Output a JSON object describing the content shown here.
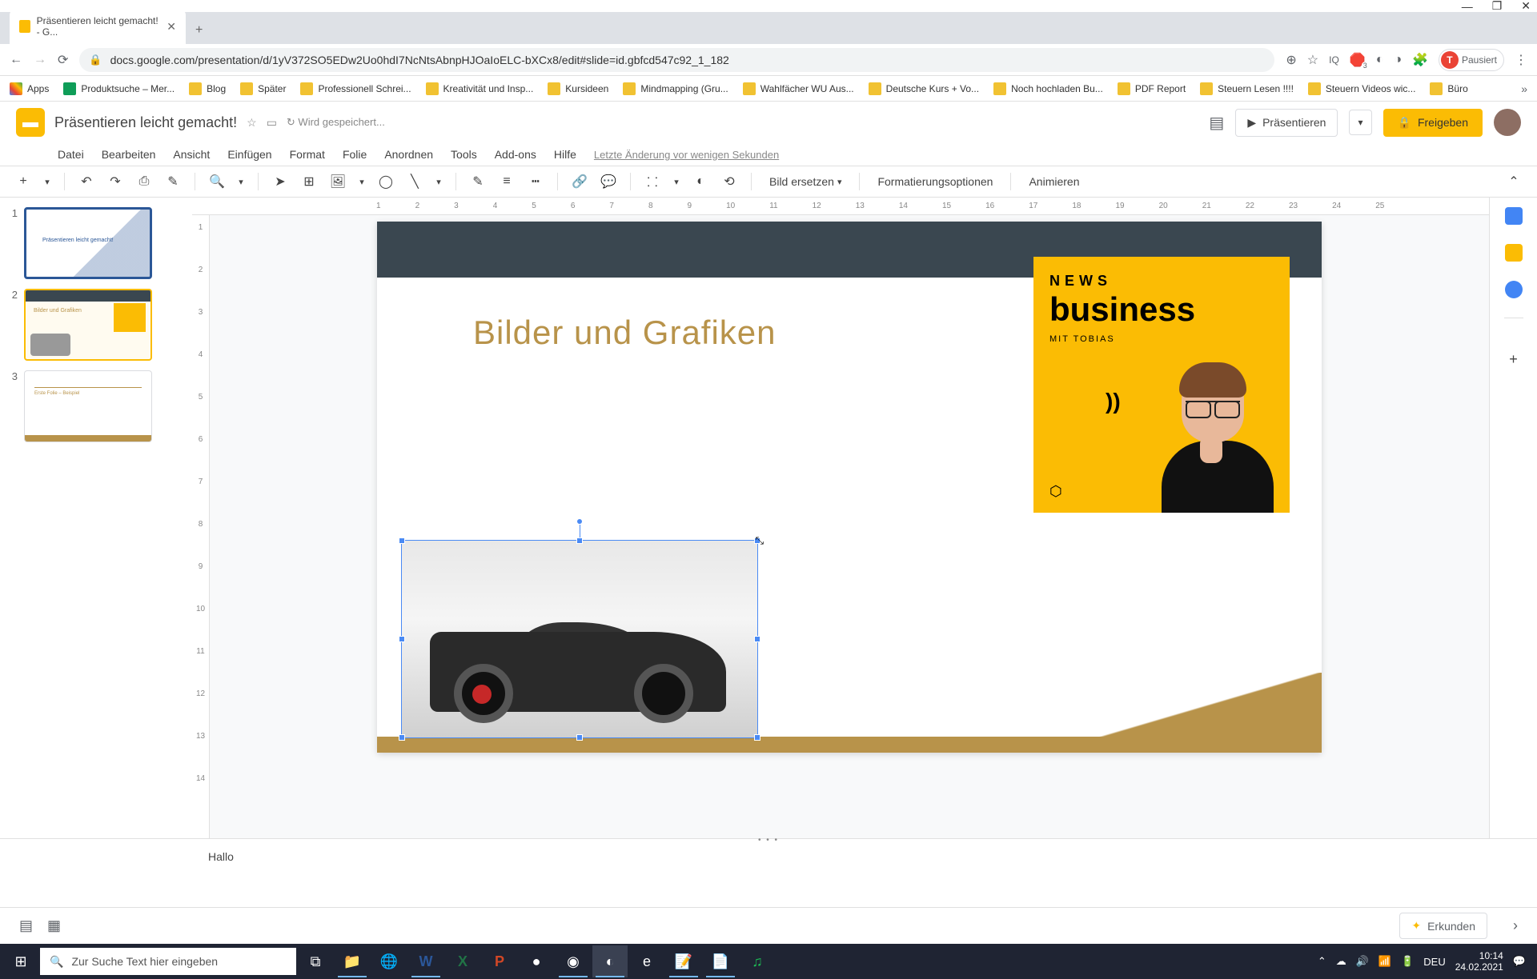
{
  "window": {
    "minimize": "—",
    "maximize": "❐",
    "close": "✕"
  },
  "browser": {
    "tab_title": "Präsentieren leicht gemacht! - G...",
    "tab_close": "✕",
    "new_tab": "+",
    "back": "←",
    "forward": "→",
    "reload": "⟳",
    "url": "docs.google.com/presentation/d/1yV372SO5EDw2Uo0hdI7NcNtsAbnpHJOaIoELC-bXCx8/edit#slide=id.gbfcd547c92_1_182",
    "zoom_icon": "⊕",
    "star": "☆",
    "reader": "IQ",
    "puzzle": "🧩",
    "blocker_count": "3",
    "menu": "⋮",
    "profile_label": "Pausiert",
    "profile_letter": "T"
  },
  "bookmarks": [
    "Apps",
    "Produktsuche – Mer...",
    "Blog",
    "Später",
    "Professionell Schrei...",
    "Kreativität und Insp...",
    "Kursideen",
    "Mindmapping  (Gru...",
    "Wahlfächer WU Aus...",
    "Deutsche Kurs + Vo...",
    "Noch hochladen Bu...",
    "PDF Report",
    "Steuern Lesen !!!!",
    "Steuern Videos wic...",
    "Büro"
  ],
  "bookmarks_more": "»",
  "app": {
    "title": "Präsentieren leicht gemacht!",
    "star": "☆",
    "move": "▭",
    "saving": "↻  Wird gespeichert...",
    "comment": "▤",
    "present_icon": "▶",
    "present": "Präsentieren",
    "present_dd": "▾",
    "share_icon": "🔒",
    "share": "Freigeben"
  },
  "menu": {
    "items": [
      "Datei",
      "Bearbeiten",
      "Ansicht",
      "Einfügen",
      "Format",
      "Folie",
      "Anordnen",
      "Tools",
      "Add-ons",
      "Hilfe"
    ],
    "last_edit": "Letzte Änderung vor wenigen Sekunden"
  },
  "toolbar": {
    "new_slide": "+",
    "new_dd": "▾",
    "undo": "↶",
    "redo": "↷",
    "print": "⎙",
    "paint": "✎",
    "zoom": "🔍",
    "zoom_dd": "▾",
    "select": "➤",
    "textbox": "⊞",
    "image": "🖼",
    "image_dd": "▾",
    "shape": "◯",
    "line": "╲",
    "line_dd": "▾",
    "border_color": "✎",
    "border_weight": "≡",
    "border_dash": "┅",
    "link": "🔗",
    "comment": "💬",
    "crop": "⸬",
    "crop_dd": "▾",
    "mask": "◐",
    "reset": "⟲",
    "replace_image": "Bild ersetzen",
    "replace_dd": "▾",
    "format_options": "Formatierungsoptionen",
    "animate": "Animieren",
    "collapse": "⌃"
  },
  "ruler_h": [
    "1",
    "2",
    "3",
    "4",
    "5",
    "6",
    "7",
    "8",
    "9",
    "10",
    "11",
    "12",
    "13",
    "14",
    "15",
    "16",
    "17",
    "18",
    "19",
    "20",
    "21",
    "22",
    "23",
    "24",
    "25"
  ],
  "ruler_v": [
    "1",
    "2",
    "3",
    "4",
    "5",
    "6",
    "7",
    "8",
    "9",
    "10",
    "11",
    "12",
    "13",
    "14"
  ],
  "thumbs": [
    {
      "num": "1",
      "title": "Präsentieren leicht gemacht!"
    },
    {
      "num": "2",
      "title": "Bilder und Grafiken"
    },
    {
      "num": "3",
      "title": "Erste Folie – Beispiel"
    }
  ],
  "slide": {
    "title": "Bilder und Grafiken",
    "news_label": "NEWS",
    "business_label": "business",
    "mit_tobias": "MIT TOBIAS",
    "arrows": "))",
    "logo_icon": "⬡"
  },
  "side_panel": {
    "plus": "+"
  },
  "notes": {
    "text": "Hallo",
    "drag": "• • •"
  },
  "bottombar": {
    "filmstrip": "▤",
    "grid": "▦",
    "explore_star": "✦",
    "explore": "Erkunden",
    "chevron": "›"
  },
  "taskbar": {
    "start": "⊞",
    "search_icon": "🔍",
    "search_placeholder": "Zur Suche Text hier eingeben",
    "cortana": "○",
    "taskview": "⧉",
    "apps": [
      "📁",
      "🌐",
      "W",
      "X",
      "P",
      "●",
      "◉",
      "◐",
      "e",
      "📝",
      "📄",
      "♫"
    ],
    "tray_up": "⌃",
    "cloud": "☁",
    "vol": "🔊",
    "wifi": "📶",
    "battery": "🔋",
    "lang": "DEU",
    "time": "10:14",
    "date": "24.02.2021",
    "notif": "💬"
  }
}
